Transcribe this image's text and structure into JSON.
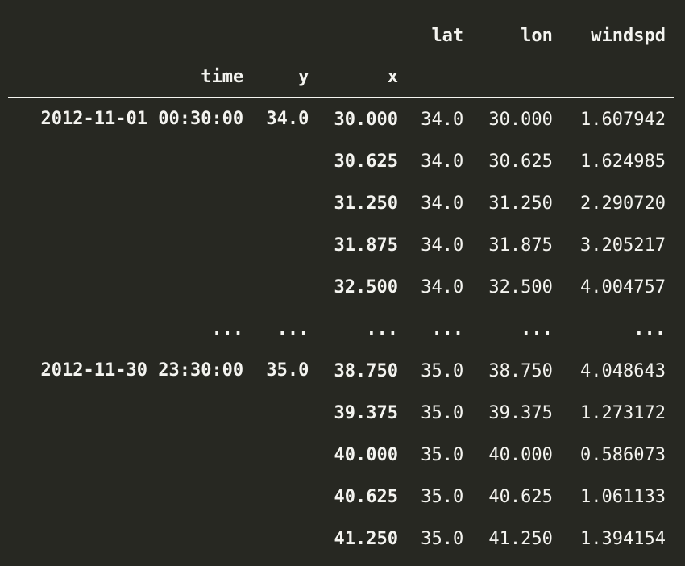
{
  "table": {
    "columns": [
      "lat",
      "lon",
      "windspd"
    ],
    "index_names": [
      "time",
      "y",
      "x"
    ],
    "top_group": {
      "time": "2012-11-01 00:30:00",
      "y": "34.0",
      "rows": [
        {
          "x": "30.000",
          "lat": "34.0",
          "lon": "30.000",
          "windspd": "1.607942"
        },
        {
          "x": "30.625",
          "lat": "34.0",
          "lon": "30.625",
          "windspd": "1.624985"
        },
        {
          "x": "31.250",
          "lat": "34.0",
          "lon": "31.250",
          "windspd": "2.290720"
        },
        {
          "x": "31.875",
          "lat": "34.0",
          "lon": "31.875",
          "windspd": "3.205217"
        },
        {
          "x": "32.500",
          "lat": "34.0",
          "lon": "32.500",
          "windspd": "4.004757"
        }
      ]
    },
    "ellipsis": "...",
    "bottom_group": {
      "time": "2012-11-30 23:30:00",
      "y": "35.0",
      "rows": [
        {
          "x": "38.750",
          "lat": "35.0",
          "lon": "38.750",
          "windspd": "4.048643"
        },
        {
          "x": "39.375",
          "lat": "35.0",
          "lon": "39.375",
          "windspd": "1.273172"
        },
        {
          "x": "40.000",
          "lat": "35.0",
          "lon": "40.000",
          "windspd": "0.586073"
        },
        {
          "x": "40.625",
          "lat": "35.0",
          "lon": "40.625",
          "windspd": "1.061133"
        },
        {
          "x": "41.250",
          "lat": "35.0",
          "lon": "41.250",
          "windspd": "1.394154"
        }
      ]
    }
  },
  "colors": {
    "background": "#272822",
    "text": "#f4f4f0"
  }
}
